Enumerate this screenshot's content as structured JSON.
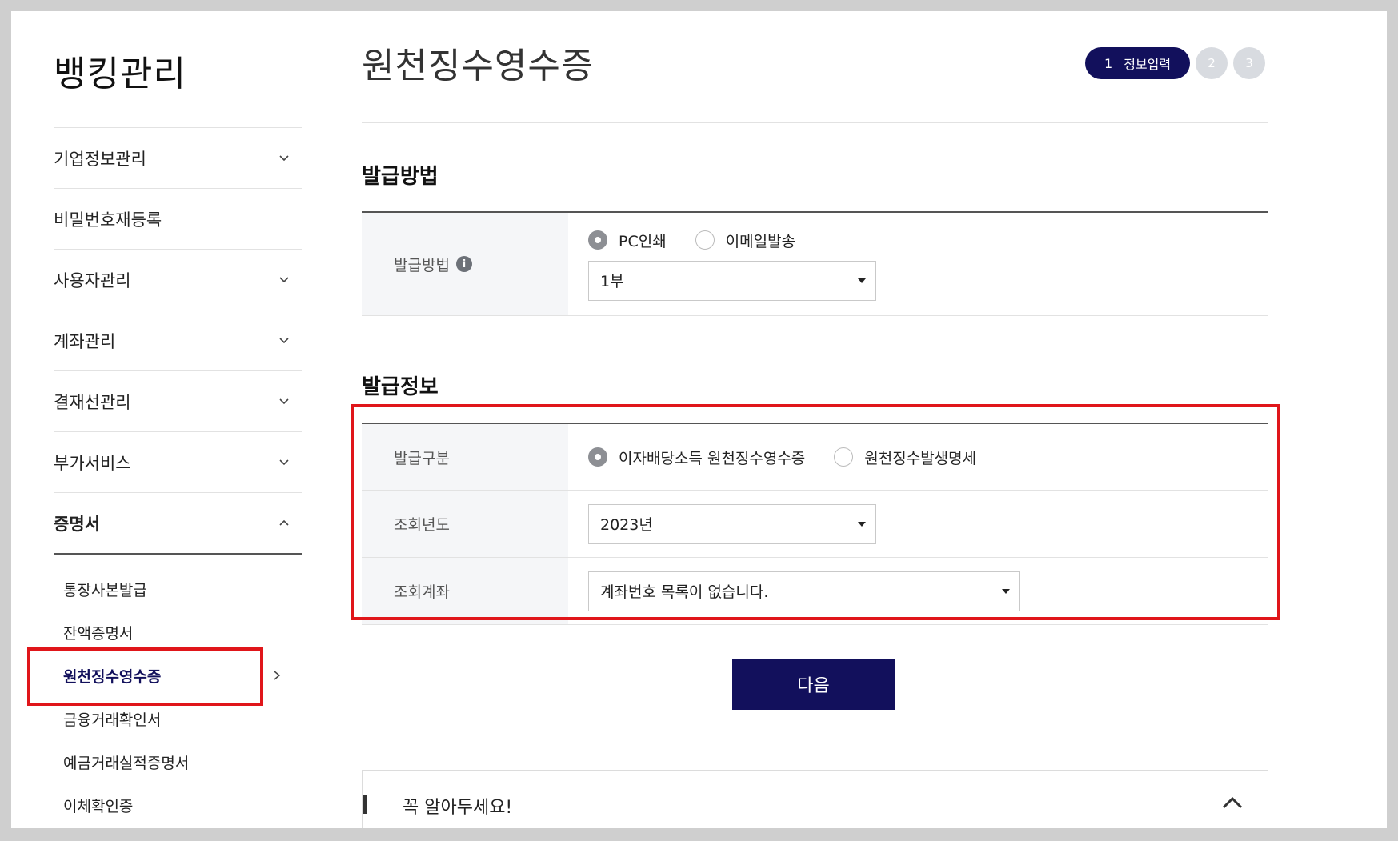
{
  "sidebar": {
    "title": "뱅킹관리",
    "items": [
      {
        "label": "기업정보관리",
        "has_chevron": true
      },
      {
        "label": "비밀번호재등록",
        "has_chevron": false
      },
      {
        "label": "사용자관리",
        "has_chevron": true
      },
      {
        "label": "계좌관리",
        "has_chevron": true
      },
      {
        "label": "결재선관리",
        "has_chevron": true
      },
      {
        "label": "부가서비스",
        "has_chevron": true
      },
      {
        "label": "증명서",
        "has_chevron": true,
        "expanded": true
      }
    ],
    "subitems": [
      {
        "label": "통장사본발급"
      },
      {
        "label": "잔액증명서"
      },
      {
        "label": "원천징수영수증",
        "active": true
      },
      {
        "label": "금융거래확인서"
      },
      {
        "label": "예금거래실적증명서"
      },
      {
        "label": "이체확인증"
      }
    ]
  },
  "main": {
    "title": "원천징수영수증",
    "steps": {
      "active_num": "1",
      "active_label": "정보입력",
      "step2": "2",
      "step3": "3"
    },
    "method_section": {
      "title": "발급방법",
      "row_label": "발급방법",
      "info_icon": "i",
      "radio_options": [
        "PC인쇄",
        "이메일발송"
      ],
      "selected_radio": "PC인쇄",
      "copies_value": "1부"
    },
    "info_section": {
      "title": "발급정보",
      "type_label": "발급구분",
      "type_options": [
        "이자배당소득 원천징수영수증",
        "원천징수발생명세"
      ],
      "type_selected": "이자배당소득 원천징수영수증",
      "year_label": "조회년도",
      "year_value": "2023년",
      "account_label": "조회계좌",
      "account_value": "계좌번호 목록이 없습니다."
    },
    "next_button": "다음",
    "notice": {
      "title": "꼭 알아두세요!"
    }
  },
  "colors": {
    "primary": "#12105c",
    "highlight": "#e0161a",
    "label_bg": "#f5f6f8",
    "inactive_step": "#d8dbe0"
  }
}
